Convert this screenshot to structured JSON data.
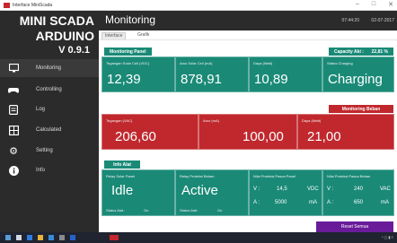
{
  "window": {
    "title": "Interface MiniScada"
  },
  "sidebar": {
    "title_line1": "MINI SCADA",
    "title_line2": "ARDUINO",
    "version": "V 0.9.1",
    "items": [
      {
        "label": "Monitoring",
        "icon": "monitor-icon"
      },
      {
        "label": "Controlling",
        "icon": "gamepad-icon"
      },
      {
        "label": "Log",
        "icon": "log-icon"
      },
      {
        "label": "Calculated",
        "icon": "calculator-icon"
      },
      {
        "label": "Setting",
        "icon": "gear-icon"
      },
      {
        "label": "Info",
        "icon": "info-icon"
      }
    ]
  },
  "header": {
    "page_title": "Monitoring",
    "time": "07:44:20",
    "date": "02-07-2017"
  },
  "tabs": [
    {
      "label": "Interface"
    },
    {
      "label": "Grafik"
    }
  ],
  "panels": {
    "monitoring_panel": {
      "title": "Monitoring Panel",
      "capacity_label": "Capacity Aki :",
      "capacity_value": "22,81 %",
      "cards": [
        {
          "label": "Tegangan Solar Cell (VDC)",
          "value": "12,39"
        },
        {
          "label": "Arus Solar Cell (mA)",
          "value": "878,91"
        },
        {
          "label": "Daya (Watt)",
          "value": "10,89"
        },
        {
          "label": "Status Charging",
          "value": "Charging"
        }
      ]
    },
    "monitoring_beban": {
      "title": "Monitoring Beban",
      "cards": [
        {
          "label": "Tegangan (VAC)",
          "value": "206,60"
        },
        {
          "label": "Arus (mA)",
          "value": "100,00"
        },
        {
          "label": "Daya (Watt)",
          "value": "21,00"
        }
      ]
    },
    "info_alat": {
      "title": "Info Alat",
      "cards": [
        {
          "label": "Relay Solar Panel",
          "value": "Idle",
          "status_label": "Status Alat :",
          "status_value": "On"
        },
        {
          "label": "Relay Proteksi Beban",
          "value": "Active",
          "status_label": "Status Alat :",
          "status_value": "On"
        },
        {
          "label": "Nilai Proteksi Pasca Panel",
          "v_label": "V :",
          "v_value": "14,5",
          "v_unit": "VDC",
          "a_label": "A :",
          "a_value": "5000",
          "a_unit": "mA"
        },
        {
          "label": "Nilai Proteksi Pasca Beban",
          "v_label": "V :",
          "v_value": "240",
          "v_unit": "VAC",
          "a_label": "A :",
          "a_value": "650",
          "a_unit": "mA"
        }
      ]
    }
  },
  "reset_button": {
    "label": "Reset Semua"
  },
  "colors": {
    "teal": "#1a8a77",
    "red": "#c0282d",
    "dark": "#2b2b2b",
    "purple": "#6a1b9a"
  }
}
